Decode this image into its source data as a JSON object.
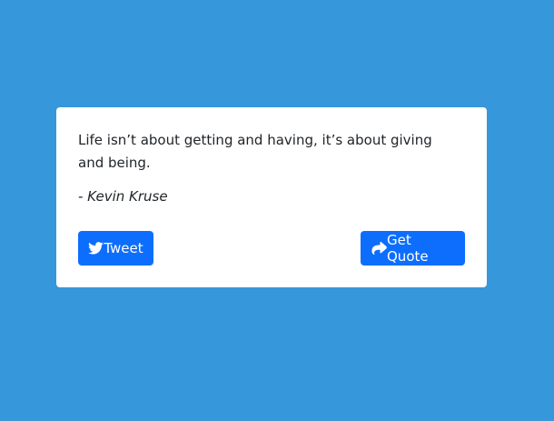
{
  "quote": {
    "text": "Life isn’t about getting and having, it’s about giving and being.",
    "author": "- Kevin Kruse"
  },
  "buttons": {
    "tweet_label": "Tweet",
    "tweet_icon": "twitter-icon",
    "get_quote_label": "Get Quote",
    "get_quote_icon": "share-arrow-icon"
  },
  "colors": {
    "background": "#3797db",
    "card": "#ffffff",
    "button": "#0d6efd",
    "text": "#212529"
  }
}
